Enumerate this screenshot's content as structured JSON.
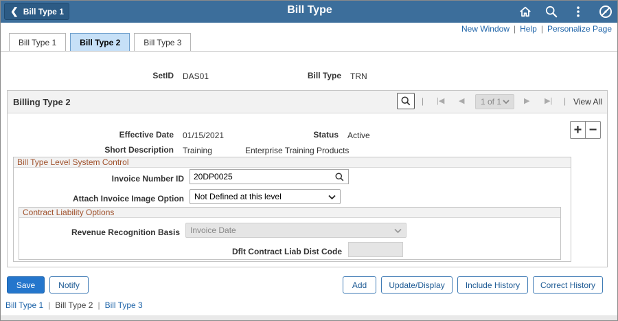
{
  "header": {
    "back_label": "Bill Type 1",
    "title": "Bill Type",
    "icons": [
      "home-icon",
      "search-icon",
      "actions-menu-icon",
      "navbar-icon"
    ],
    "color": "#3c6e9b"
  },
  "top_links": {
    "new_window": "New Window",
    "help": "Help",
    "personalize": "Personalize Page"
  },
  "tabs": [
    {
      "label": "Bill Type 1",
      "active": false
    },
    {
      "label": "Bill Type 2",
      "active": true
    },
    {
      "label": "Bill Type 3",
      "active": false
    }
  ],
  "key_fields": {
    "setid_label": "SetID",
    "setid_value": "DAS01",
    "bill_type_label": "Bill Type",
    "bill_type_value": "TRN"
  },
  "billing_grid": {
    "title": "Billing Type 2",
    "rows_selector": "1 of 1",
    "view_all": "View All",
    "effective_date_label": "Effective Date",
    "effective_date": "01/15/2021",
    "status_label": "Status",
    "status": "Active",
    "short_desc_label": "Short Description",
    "short_desc": "Training",
    "long_desc": "Enterprise Training Products",
    "system_control": {
      "title": "Bill Type Level System Control",
      "invoice_number_id_label": "Invoice Number ID",
      "invoice_number_id": "20DP0025",
      "attach_image_label": "Attach Invoice Image Option",
      "attach_image_value": "Not Defined at this level"
    },
    "contract_liability": {
      "title": "Contract Liability Options",
      "rev_rec_label": "Revenue Recognition Basis",
      "rev_rec_value": "Invoice Date",
      "dflt_code_label": "Dflt Contract Liab Dist Code",
      "dflt_code_value": ""
    }
  },
  "buttons": {
    "save": "Save",
    "notify": "Notify",
    "add": "Add",
    "update_display": "Update/Display",
    "include_history": "Include History",
    "correct_history": "Correct History"
  },
  "bottom_links": {
    "bill_type_1": "Bill Type 1",
    "bill_type_2": "Bill Type 2",
    "bill_type_3": "Bill Type 3"
  }
}
